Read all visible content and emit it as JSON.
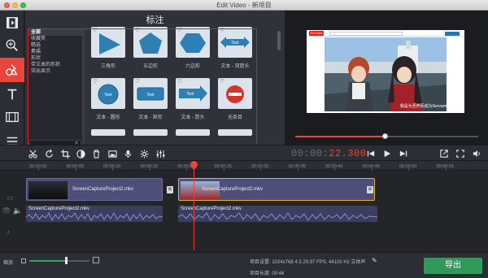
{
  "window": {
    "title": "Edit Video - 新项目"
  },
  "panel": {
    "title": "标注",
    "categories": [
      "全部",
      "收藏夹",
      "精选",
      "素描",
      "形状",
      "带文本的形状",
      "突出显示"
    ],
    "items": [
      {
        "label": "三角形"
      },
      {
        "label": "五边形"
      },
      {
        "label": "六边形"
      },
      {
        "label": "文本 - 双箭头",
        "text": "Text"
      },
      {
        "label": "文本 - 圆形",
        "text": "Text"
      },
      {
        "label": "文本 - 矩形",
        "text": "Text"
      },
      {
        "label": "文本 - 箭头",
        "text": "Text"
      },
      {
        "label": "无条目"
      }
    ]
  },
  "preview": {
    "subtitle": "我是为圣杯而成为Servant",
    "yt_logo": "YouTube",
    "playback_progress": 0.49
  },
  "toolbar": {
    "timecode_dim": "00:00:",
    "timecode_red": "22.300"
  },
  "ruler": {
    "ticks": [
      "00:00:00",
      "00:00:05",
      "00:00:10",
      "00:00:15",
      "00:00:20",
      "00:00:25",
      "00:00:30",
      "00:00:35",
      "00:00:40",
      "00:00:45",
      "00:00:50",
      "00:00:55"
    ]
  },
  "timeline": {
    "clip1": {
      "name": "ScreenCaptureProject2.mkv"
    },
    "clip2": {
      "name": "ScreenCaptureProject2.mkv"
    },
    "audio1": {
      "name": "ScreenCaptureProject2.mkv"
    },
    "audio2": {
      "name": "ScreenCaptureProject2.mkv"
    }
  },
  "footer": {
    "zoom_label": "缩放:",
    "zoom_level": 0.62,
    "settings": "项目设置:  1024x768 4:3 29.97 FPS, 44100 Hz 立体声",
    "length": "项目长度:  00:46",
    "export_label": "导出"
  },
  "colors": {
    "accent": "#e8453c",
    "export": "#2f9b5a",
    "highlight_box": "#d8202a"
  }
}
